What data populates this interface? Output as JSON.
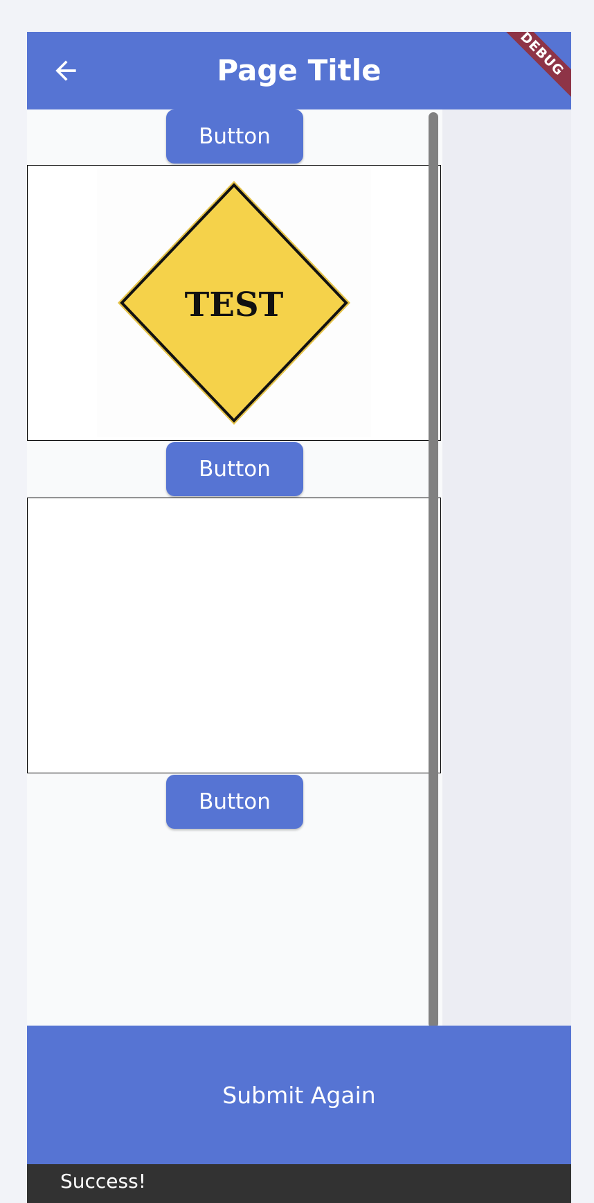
{
  "app_bar": {
    "title": "Page Title",
    "back_icon": "arrow-left-icon",
    "debug_label": "DEBUG"
  },
  "content": {
    "buttons": [
      {
        "label": "Button"
      },
      {
        "label": "Button"
      },
      {
        "label": "Button"
      }
    ],
    "image": {
      "sign_text": "TEST",
      "sign_color": "#f5d24a"
    }
  },
  "bottom_bar": {
    "label": "Submit Again"
  },
  "snackbar": {
    "message": "Success!"
  },
  "colors": {
    "primary": "#5674d3",
    "debug_ribbon": "#8e3447",
    "snackbar": "#323232"
  }
}
